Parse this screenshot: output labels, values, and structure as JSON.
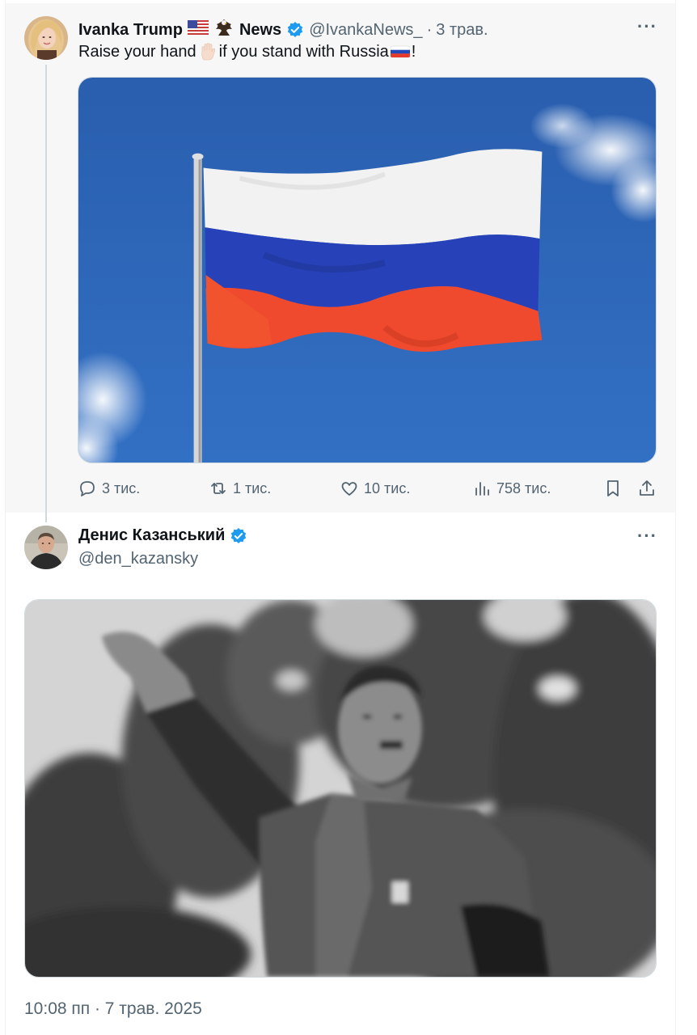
{
  "parent_tweet": {
    "author_name": "Ivanka Trump",
    "author_name_suffix": "News",
    "handle": "@IvankaNews_",
    "separator": "·",
    "time": "3 трав.",
    "text_before_hand": "Raise your hand",
    "text_after_hand": "if you stand with Russia",
    "text_end": "!",
    "more_label": "···",
    "actions": {
      "replies": "3 тис.",
      "reposts": "1 тис.",
      "likes": "10 тис.",
      "views": "758 тис."
    }
  },
  "reply_tweet": {
    "author_name": "Денис Казанський",
    "handle": "@den_kazansky",
    "more_label": "···",
    "timestamp": "10:08 пп · 7 трав. 2025"
  },
  "colors": {
    "verified_blue": "#1d9bf0",
    "text_secondary": "#536471",
    "flag_white": "#f2f2f2",
    "flag_blue": "#2742b8",
    "flag_red": "#f04a2e",
    "sky_blue": "#2c63b3"
  },
  "icons": [
    "reply-icon",
    "repost-icon",
    "like-icon",
    "views-icon",
    "bookmark-icon",
    "share-icon",
    "verified-badge-icon",
    "more-options-icon"
  ]
}
